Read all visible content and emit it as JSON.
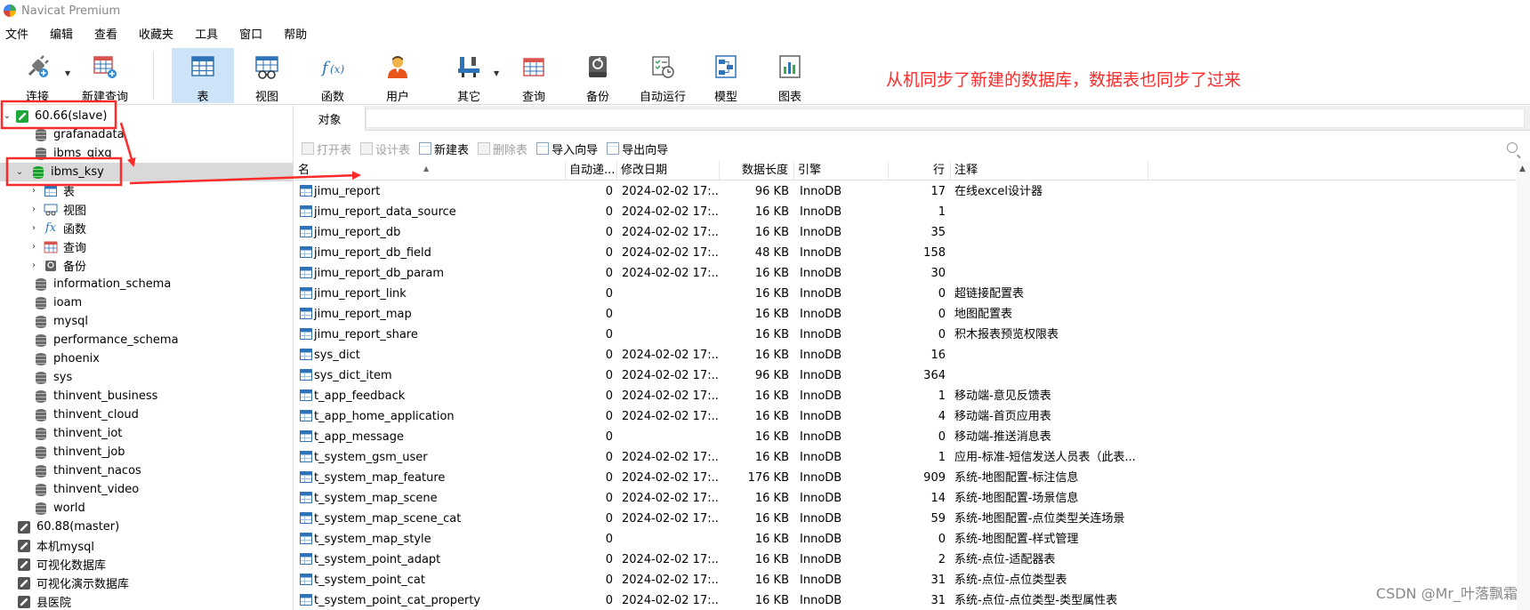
{
  "window": {
    "title": "Navicat Premium"
  },
  "menu": [
    "文件",
    "编辑",
    "查看",
    "收藏夹",
    "工具",
    "窗口",
    "帮助"
  ],
  "toolbar": {
    "buttons": [
      {
        "label": "连接",
        "icon": "plug-icon"
      },
      {
        "label": "新建查询",
        "icon": "new-query-icon"
      },
      {
        "label": "表",
        "icon": "table-icon",
        "active": true
      },
      {
        "label": "视图",
        "icon": "view-icon"
      },
      {
        "label": "函数",
        "icon": "function-icon"
      },
      {
        "label": "用户",
        "icon": "user-icon"
      },
      {
        "label": "其它",
        "icon": "tools-icon"
      },
      {
        "label": "查询",
        "icon": "query-icon"
      },
      {
        "label": "备份",
        "icon": "backup-icon"
      },
      {
        "label": "自动运行",
        "icon": "schedule-icon"
      },
      {
        "label": "模型",
        "icon": "model-icon"
      },
      {
        "label": "图表",
        "icon": "chart-icon"
      }
    ]
  },
  "annotation": "从机同步了新建的数据库，数据表也同步了过来",
  "tree": [
    {
      "label": "60.66(slave)",
      "kind": "connection-open",
      "level": 0,
      "expanded": true
    },
    {
      "label": "grafanadata",
      "kind": "db",
      "level": 1
    },
    {
      "label": "ibms_qixg",
      "kind": "db",
      "level": 1
    },
    {
      "label": "ibms_ksy",
      "kind": "db-open",
      "level": 1,
      "expanded": true,
      "selected": true
    },
    {
      "label": "表",
      "kind": "tables",
      "level": 2
    },
    {
      "label": "视图",
      "kind": "views",
      "level": 2
    },
    {
      "label": "函数",
      "kind": "functions",
      "level": 2
    },
    {
      "label": "查询",
      "kind": "queries",
      "level": 2
    },
    {
      "label": "备份",
      "kind": "backups",
      "level": 2
    },
    {
      "label": "information_schema",
      "kind": "db",
      "level": 1
    },
    {
      "label": "ioam",
      "kind": "db",
      "level": 1
    },
    {
      "label": "mysql",
      "kind": "db",
      "level": 1
    },
    {
      "label": "performance_schema",
      "kind": "db",
      "level": 1
    },
    {
      "label": "phoenix",
      "kind": "db",
      "level": 1
    },
    {
      "label": "sys",
      "kind": "db",
      "level": 1
    },
    {
      "label": "thinvent_business",
      "kind": "db",
      "level": 1
    },
    {
      "label": "thinvent_cloud",
      "kind": "db",
      "level": 1
    },
    {
      "label": "thinvent_iot",
      "kind": "db",
      "level": 1
    },
    {
      "label": "thinvent_job",
      "kind": "db",
      "level": 1
    },
    {
      "label": "thinvent_nacos",
      "kind": "db",
      "level": 1
    },
    {
      "label": "thinvent_video",
      "kind": "db",
      "level": 1
    },
    {
      "label": "world",
      "kind": "db",
      "level": 1
    },
    {
      "label": "60.88(master)",
      "kind": "connection",
      "level": 0
    },
    {
      "label": "本机mysql",
      "kind": "connection",
      "level": 0
    },
    {
      "label": "可视化数据库",
      "kind": "connection",
      "level": 0
    },
    {
      "label": "可视化演示数据库",
      "kind": "connection",
      "level": 0
    },
    {
      "label": "县医院",
      "kind": "connection",
      "level": 0
    }
  ],
  "object_tab": "对象",
  "object_toolbar": [
    {
      "label": "打开表",
      "enabled": false
    },
    {
      "label": "设计表",
      "enabled": false
    },
    {
      "label": "新建表",
      "enabled": true
    },
    {
      "label": "删除表",
      "enabled": false
    },
    {
      "label": "导入向导",
      "enabled": true
    },
    {
      "label": "导出向导",
      "enabled": true
    }
  ],
  "grid": {
    "columns": [
      "名",
      "自动递...",
      "修改日期",
      "数据长度",
      "引擎",
      "行",
      "注释"
    ],
    "rows": [
      [
        "jimu_report",
        "0",
        "2024-02-02 17:...",
        "96 KB",
        "InnoDB",
        "17",
        "在线excel设计器"
      ],
      [
        "jimu_report_data_source",
        "0",
        "2024-02-02 17:...",
        "16 KB",
        "InnoDB",
        "1",
        ""
      ],
      [
        "jimu_report_db",
        "0",
        "2024-02-02 17:...",
        "16 KB",
        "InnoDB",
        "35",
        ""
      ],
      [
        "jimu_report_db_field",
        "0",
        "2024-02-02 17:...",
        "48 KB",
        "InnoDB",
        "158",
        ""
      ],
      [
        "jimu_report_db_param",
        "0",
        "2024-02-02 17:...",
        "16 KB",
        "InnoDB",
        "30",
        ""
      ],
      [
        "jimu_report_link",
        "0",
        "",
        "16 KB",
        "InnoDB",
        "0",
        "超链接配置表"
      ],
      [
        "jimu_report_map",
        "0",
        "",
        "16 KB",
        "InnoDB",
        "0",
        "地图配置表"
      ],
      [
        "jimu_report_share",
        "0",
        "",
        "16 KB",
        "InnoDB",
        "0",
        "积木报表预览权限表"
      ],
      [
        "sys_dict",
        "0",
        "2024-02-02 17:...",
        "16 KB",
        "InnoDB",
        "16",
        ""
      ],
      [
        "sys_dict_item",
        "0",
        "2024-02-02 17:...",
        "96 KB",
        "InnoDB",
        "364",
        ""
      ],
      [
        "t_app_feedback",
        "0",
        "2024-02-02 17:...",
        "16 KB",
        "InnoDB",
        "1",
        "移动端-意见反馈表"
      ],
      [
        "t_app_home_application",
        "0",
        "2024-02-02 17:...",
        "16 KB",
        "InnoDB",
        "4",
        "移动端-首页应用表"
      ],
      [
        "t_app_message",
        "0",
        "",
        "16 KB",
        "InnoDB",
        "0",
        "移动端-推送消息表"
      ],
      [
        "t_system_gsm_user",
        "0",
        "2024-02-02 17:...",
        "16 KB",
        "InnoDB",
        "1",
        "应用-标准-短信发送人员表（此表..."
      ],
      [
        "t_system_map_feature",
        "0",
        "2024-02-02 17:...",
        "176 KB",
        "InnoDB",
        "909",
        "系统-地图配置-标注信息"
      ],
      [
        "t_system_map_scene",
        "0",
        "2024-02-02 17:...",
        "16 KB",
        "InnoDB",
        "14",
        "系统-地图配置-场景信息"
      ],
      [
        "t_system_map_scene_cat",
        "0",
        "2024-02-02 17:...",
        "16 KB",
        "InnoDB",
        "59",
        "系统-地图配置-点位类型关连场景"
      ],
      [
        "t_system_map_style",
        "0",
        "",
        "16 KB",
        "InnoDB",
        "0",
        "系统-地图配置-样式管理"
      ],
      [
        "t_system_point_adapt",
        "0",
        "2024-02-02 17:...",
        "16 KB",
        "InnoDB",
        "2",
        "系统-点位-适配器表"
      ],
      [
        "t_system_point_cat",
        "0",
        "2024-02-02 17:...",
        "16 KB",
        "InnoDB",
        "31",
        "系统-点位-点位类型表"
      ],
      [
        "t_system_point_cat_property",
        "0",
        "2024-02-02 17:...",
        "16 KB",
        "InnoDB",
        "31",
        "系统-点位-点位类型-类型属性表"
      ]
    ]
  },
  "watermark": "CSDN @Mr_叶落飘霜",
  "colors": {
    "annotation": "#ff2a2a",
    "active_toolbar": "#cde3f7",
    "selected_row": "#d9d9d9"
  }
}
